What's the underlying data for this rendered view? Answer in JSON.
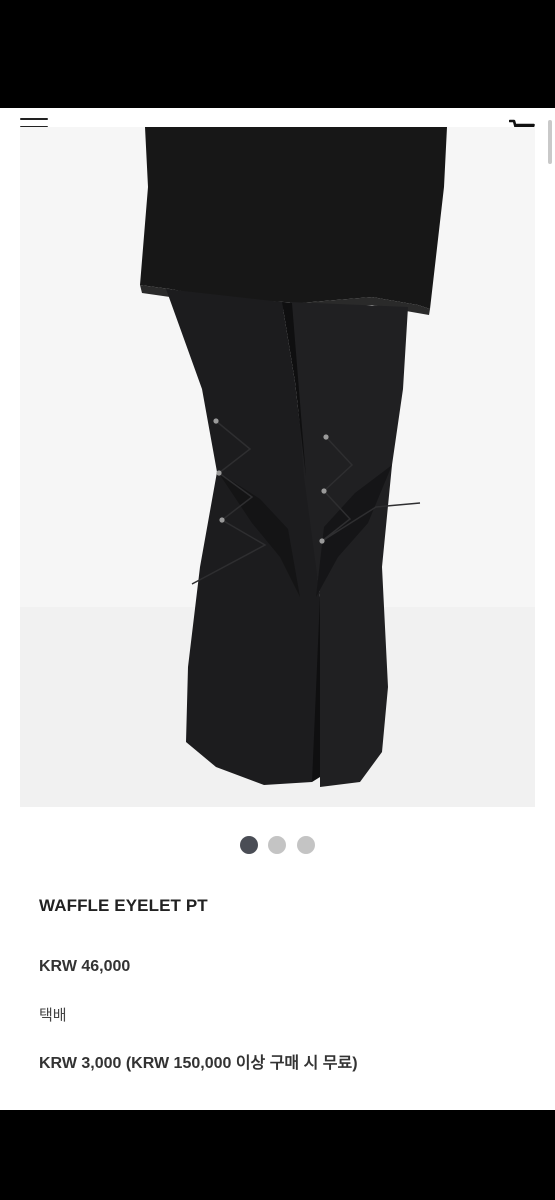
{
  "header": {
    "menu_icon": "hamburger-menu-icon",
    "cart_icon": "shopping-cart-icon"
  },
  "carousel": {
    "current": 1,
    "total": 3,
    "active_color": "#4a4d55",
    "inactive_color": "#c4c4c4"
  },
  "product": {
    "title": "WAFFLE EYELET PT",
    "price": "KRW 46,000",
    "shipping_method": "택배",
    "shipping_fee": "KRW 3,000 (KRW 150,000 이상 구매 시 무료)"
  }
}
